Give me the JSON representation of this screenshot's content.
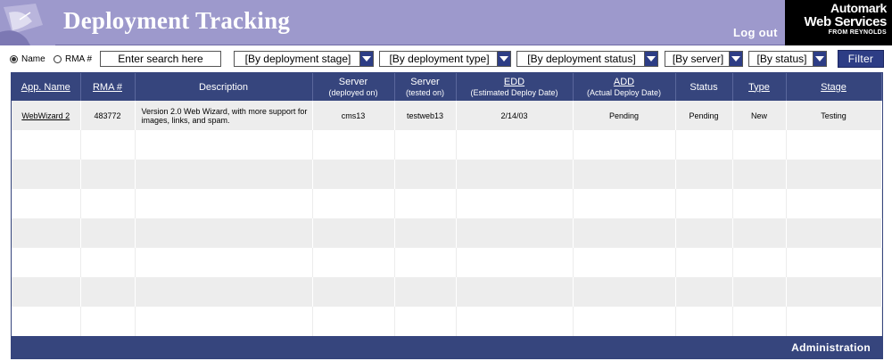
{
  "header": {
    "title": "Deployment Tracking",
    "logout_label": "Log out",
    "brand": {
      "line1": "Automark",
      "line2": "Web Services",
      "line3": "FROM REYNOLDS"
    },
    "colors": {
      "header_bg": "#9d99cc",
      "brand_bg": "#000000"
    }
  },
  "filters": {
    "radio_name_label": "Name",
    "radio_rma_label": "RMA #",
    "search_value": "Enter search here",
    "stage": "[By deployment stage]",
    "type": "[By deployment type]",
    "status": "[By deployment status]",
    "server": "[By server]",
    "by_status": "[By status]",
    "filter_button": "Filter"
  },
  "table": {
    "columns": [
      {
        "label": "App. Name",
        "sub": "",
        "link": true
      },
      {
        "label": "RMA #",
        "sub": "",
        "link": true
      },
      {
        "label": "Description",
        "sub": "",
        "link": false
      },
      {
        "label": "Server",
        "sub": "(deployed on)",
        "link": false
      },
      {
        "label": "Server",
        "sub": "(tested on)",
        "link": false
      },
      {
        "label": "EDD",
        "sub": "(Estimated Deploy Date)",
        "link": true
      },
      {
        "label": "ADD",
        "sub": "(Actual Deploy Date)",
        "link": true
      },
      {
        "label": "Status",
        "sub": "",
        "link": false
      },
      {
        "label": "Type",
        "sub": "",
        "link": true
      },
      {
        "label": "Stage",
        "sub": "",
        "link": true
      }
    ],
    "rows": [
      {
        "app_name": "WebWizard 2",
        "rma": "483772",
        "description": "Version 2.0 Web Wizard, with more support for images, links, and spam.",
        "server_deployed": "cms13",
        "server_tested": "testweb13",
        "edd": "2/14/03",
        "add": "Pending",
        "status": "Pending",
        "type": "New",
        "stage": "Testing"
      }
    ],
    "admin_label": "Administration",
    "colors": {
      "panel_bg": "#36457d",
      "row_alt": "#ededed"
    }
  }
}
